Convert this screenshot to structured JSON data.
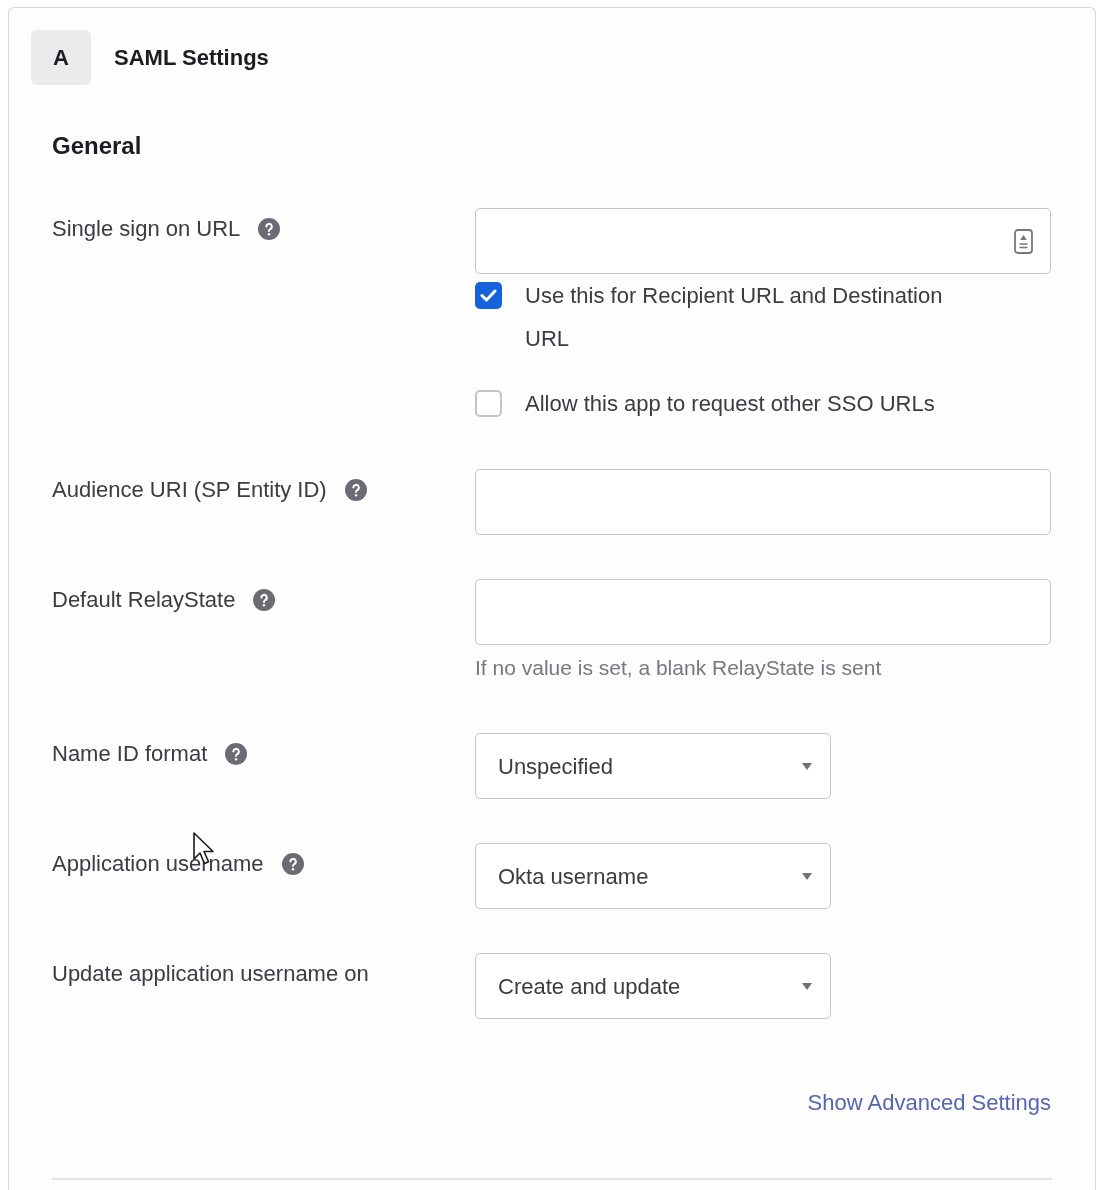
{
  "section": {
    "badge": "A",
    "title": "SAML Settings"
  },
  "group": {
    "title": "General"
  },
  "fields": [
    {
      "kind": "text",
      "label": "Single sign on URL",
      "help": true,
      "autofill_icon": true,
      "options": [
        {
          "label": "Use this for Recipient URL and Destination URL",
          "checked": true
        },
        {
          "label": "Allow this app to request other SSO URLs",
          "checked": false
        }
      ]
    },
    {
      "kind": "text",
      "label": "Audience URI (SP Entity ID)",
      "help": true,
      "autofill_icon": false
    },
    {
      "kind": "text",
      "label": "Default RelayState",
      "help": true,
      "autofill_icon": false,
      "hint": "If no value is set, a blank RelayState is sent"
    },
    {
      "kind": "select",
      "label": "Name ID format",
      "help": true,
      "value": "Unspecified"
    },
    {
      "kind": "select",
      "label": "Application username",
      "help": true,
      "value": "Okta username"
    },
    {
      "kind": "select",
      "label": "Update application username on",
      "help": false,
      "value": "Create and update"
    }
  ],
  "advanced_link": "Show Advanced Settings"
}
